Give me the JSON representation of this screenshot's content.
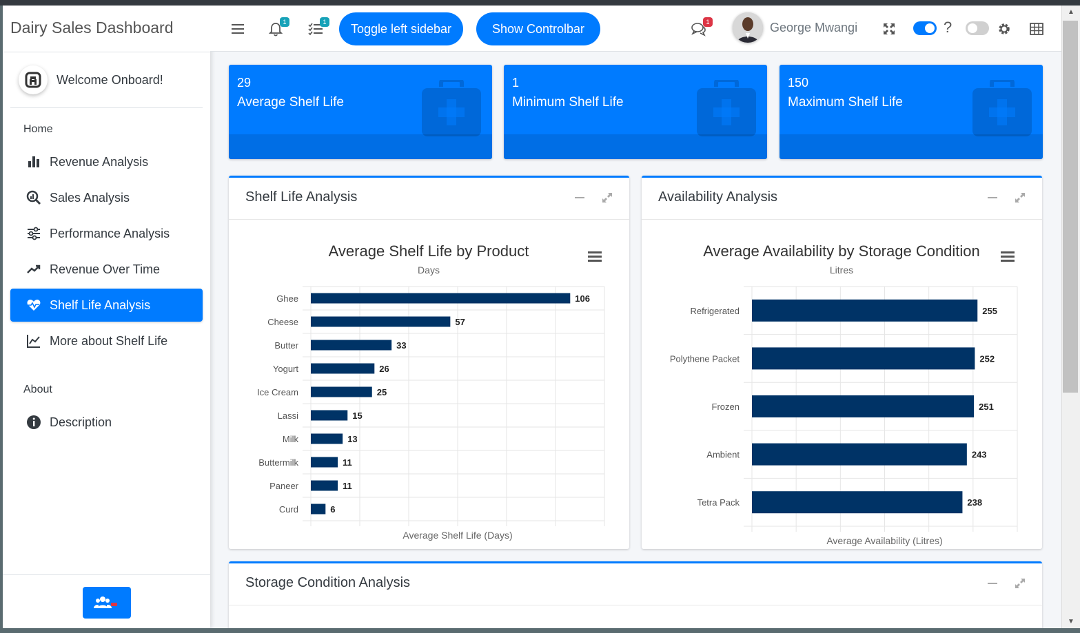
{
  "sidebar": {
    "brand": "Dairy Sales Dashboard",
    "welcome": "Welcome Onboard!",
    "home_header": "Home",
    "about_header": "About",
    "items": [
      {
        "label": "Revenue Analysis",
        "icon": "bar-chart-icon"
      },
      {
        "label": "Sales Analysis",
        "icon": "search-chart-icon"
      },
      {
        "label": "Performance Analysis",
        "icon": "sliders-icon"
      },
      {
        "label": "Revenue Over Time",
        "icon": "trend-up-icon"
      },
      {
        "label": "Shelf Life Analysis",
        "icon": "heartbeat-icon",
        "active": true
      },
      {
        "label": "More about Shelf Life",
        "icon": "line-chart-icon"
      }
    ],
    "about_items": [
      {
        "label": "Description",
        "icon": "info-icon"
      }
    ]
  },
  "header": {
    "notifications_count": "1",
    "tasks_count": "1",
    "toggle_sidebar_label": "Toggle left sidebar",
    "show_controlbar_label": "Show Controlbar",
    "messages_count": "1",
    "user_name": "George Mwangi",
    "help_label": "?"
  },
  "infoboxes": [
    {
      "value": "29",
      "label": "Average Shelf Life"
    },
    {
      "value": "1",
      "label": "Minimum Shelf Life"
    },
    {
      "value": "150",
      "label": "Maximum Shelf Life"
    }
  ],
  "cards": {
    "shelf": "Shelf Life Analysis",
    "availability": "Availability Analysis",
    "storage": "Storage Condition Analysis"
  },
  "colors": {
    "primary": "#007bff",
    "bar": "#003366"
  },
  "chart_data": [
    {
      "type": "bar",
      "orientation": "horizontal",
      "title": "Average Shelf Life by Product",
      "subtitle": "Days",
      "xlabel": "Average Shelf Life (Days)",
      "categories": [
        "Ghee",
        "Cheese",
        "Butter",
        "Yogurt",
        "Ice Cream",
        "Lassi",
        "Milk",
        "Buttermilk",
        "Paneer",
        "Curd"
      ],
      "values": [
        106,
        57,
        33,
        26,
        25,
        15,
        13,
        11,
        11,
        6
      ],
      "xlim": [
        0,
        120
      ],
      "grid": true
    },
    {
      "type": "bar",
      "orientation": "horizontal",
      "title": "Average Availability by Storage Condition",
      "subtitle": "Litres",
      "xlabel": "Average Availability (Litres)",
      "categories": [
        "Refrigerated",
        "Polythene Packet",
        "Frozen",
        "Ambient",
        "Tetra Pack"
      ],
      "values": [
        255,
        252,
        251,
        243,
        238
      ],
      "xlim": [
        0,
        300
      ],
      "grid": true
    }
  ]
}
